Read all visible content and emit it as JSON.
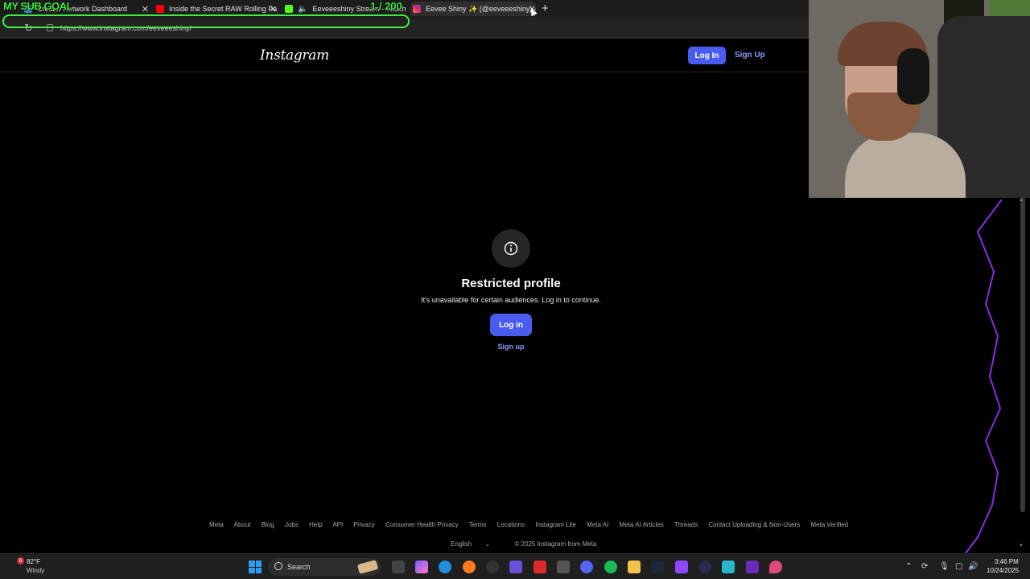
{
  "overlay": {
    "sub_goal": "MY SUB GOAL",
    "sub_count": "1 / 200"
  },
  "tabs": [
    {
      "title": "Creator Network Dashboard",
      "icon": "dashboard-icon"
    },
    {
      "title": "Inside the Secret RAW Rolling Pap",
      "icon": "youtube-icon"
    },
    {
      "title": "Eeveeeshiny Stream - Watch",
      "icon": "kick-icon"
    },
    {
      "title": "Eevee Shiny ✨ (@eeveeeshiny) -",
      "icon": "instagram-icon"
    }
  ],
  "address": {
    "url": "https://www.instagram.com/eeveeeshiny/"
  },
  "header": {
    "logo": "Instagram",
    "login": "Log In",
    "signup": "Sign Up"
  },
  "restricted": {
    "title": "Restricted profile",
    "subtitle": "It's unavailable for certain audiences. Log in to continue.",
    "login": "Log in",
    "signup": "Sign up"
  },
  "footer": {
    "links": [
      "Meta",
      "About",
      "Blog",
      "Jobs",
      "Help",
      "API",
      "Privacy",
      "Consumer Health Privacy",
      "Terms",
      "Locations",
      "Instagram Lite",
      "Meta AI",
      "Meta AI Articles",
      "Threads",
      "Contact Uploading & Non-Users",
      "Meta Verified"
    ],
    "language": "English",
    "copyright": "© 2025 Instagram from Meta"
  },
  "taskbar": {
    "weather_badge": "8",
    "weather_temp": "82°F",
    "weather_desc": "Windy",
    "search": "Search",
    "time": "3:46 PM",
    "date": "10/24/2025"
  },
  "colors": {
    "ig_blue": "#4a5cf0",
    "ig_link": "#8b9dff",
    "sub_goal_green": "#3ef03e",
    "accent_purple": "#8b2be2"
  }
}
